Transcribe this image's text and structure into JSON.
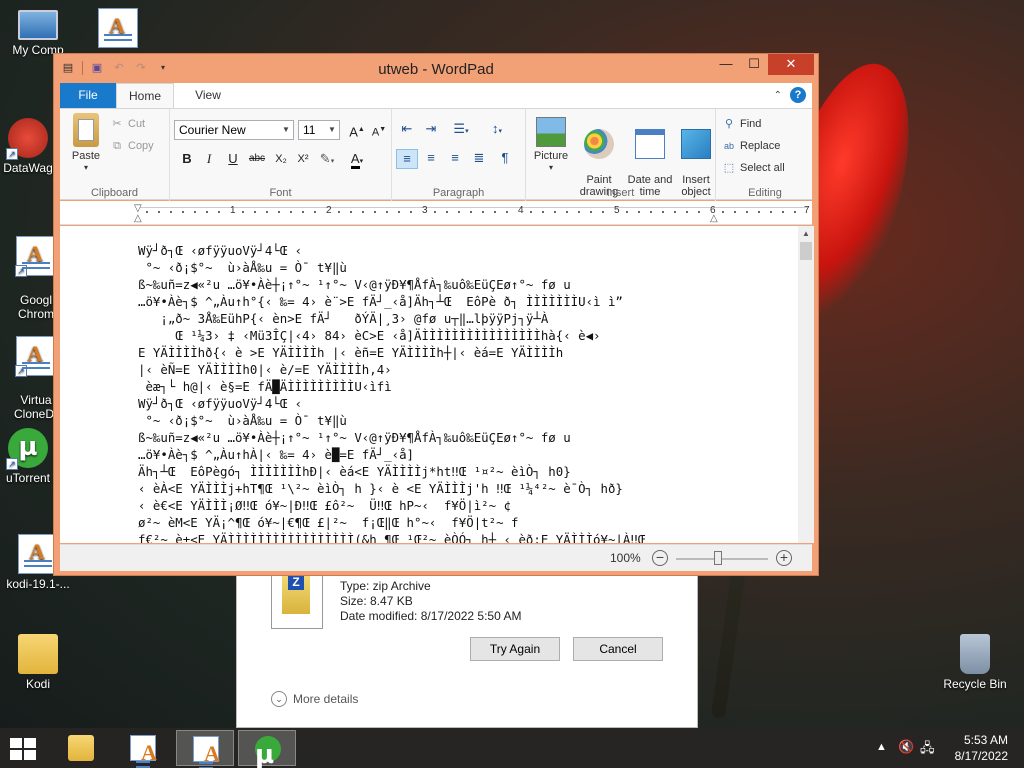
{
  "desktop": {
    "icons": [
      {
        "label": "My Comp",
        "icon": "computer-icon"
      },
      {
        "label": "",
        "icon": "wordpad-doc-icon"
      },
      {
        "label": "DataWag",
        "icon": "datawag-icon"
      },
      {
        "label": "Googl\nChrom",
        "icon": "wordpad-doc-icon"
      },
      {
        "label": "Virtua\nCloneDr",
        "icon": "wordpad-doc-icon"
      },
      {
        "label": "uTorrent",
        "icon": "utorrent-icon"
      },
      {
        "label": "kodi-19.1-...",
        "icon": "wordpad-doc-icon"
      },
      {
        "label": "Kodi",
        "icon": "folder-icon"
      },
      {
        "label": "Recycle Bin",
        "icon": "recycle-bin-icon"
      }
    ]
  },
  "dialog": {
    "type": "Type: zip Archive",
    "size": "Size: 8.47 KB",
    "modified": "Date modified: 8/17/2022 5:50 AM",
    "try_again": "Try Again",
    "cancel": "Cancel",
    "more_details": "More details"
  },
  "window": {
    "title": "utweb - WordPad",
    "tabs": {
      "file": "File",
      "home": "Home",
      "view": "View"
    },
    "clipboard": {
      "paste": "Paste",
      "cut": "Cut",
      "copy": "Copy",
      "label": "Clipboard"
    },
    "font": {
      "family": "Courier New",
      "size": "11",
      "label": "Font"
    },
    "paragraph": {
      "label": "Paragraph"
    },
    "insert": {
      "picture": "Picture",
      "paint_drawing": "Paint\ndrawing",
      "date_time": "Date and\ntime",
      "insert_object": "Insert\nobject",
      "label": "Insert"
    },
    "editing": {
      "find": "Find",
      "replace": "Replace",
      "select_all": "Select all",
      "label": "Editing"
    },
    "ruler_numbers": [
      "1",
      "2",
      "3",
      "4",
      "5",
      "6",
      "7"
    ],
    "document_lines": [
      "Wÿ┘ð┐Œ ‹øfÿÿuoVÿ┘4└Œ ‹",
      " °~ ‹ð¡$°~  ù›àÅ‰u = Ò¯ t¥‖ù",
      "ß~‰uñ=z◀«²u …ö¥•Àè┼¡↑°~ ¹↑°~ V‹@↑ÿÐ¥¶ÅfÀ┐‰uô‰EüÇEø↑°~ fø u",
      "…ö¥•Àè┐$ ^„Àu↑h°{‹ ‰= 4› è¨>E fÄ┘_‹å]Äh┐┴Œ  EôPè ð┐ ÌÌÌÌÌÌÌU‹ì ì”",
      "   ¡„ð~ 3Å‰EühP{‹ èn>E fÄ┘   ðÝÄ|¸3› @fø u┬‖…lþÿÿPj┐ÿ┴À",
      "     Œ ¹¼3› ‡ ‹Mü3ÎÇ|‹4› 84› èC>E ‹å]ÄÌÌÌÌÌÌÌÌÌÌÌÌÌÌÌÌhà{‹ è◀›",
      "E YÄÌÌÌÌhð{‹ è >E YÄÌÌÌÌh |‹ èñ=E YÄÌÌÌÌh┼|‹ èá=E YÄÌÌÌÌh",
      "|‹ èÑ=E YÄÌÌÌÌh0|‹ è∕=E YÄÌÌÌÌh,4›",
      " èæ┐└ h@|‹ è§=E fÄ█ÄÌÌÌÌÌÌÌÌÌU‹ìfì",
      "Wÿ┘ð┐Œ ‹øfÿÿuoVÿ┘4└Œ ‹",
      " °~ ‹ð¡$°~  ù›àÅ‰u = Ò¯ t¥‖ù",
      "ß~‰uñ=z◀«²u …ö¥•Àè┼¡↑°~ ¹↑°~ V‹@↑ÿÐ¥¶ÅfÀ┐‰uô‰EüÇEø↑°~ fø u",
      "…ö¥•Àè┐$ ^„Àu↑hÀ|‹ ‰= 4› è█=E fÄ┘_‹å]",
      "Äh┐┴Œ  EôPègó┐ ÌÌÌÌÌÌÌhÐ|‹ èá<E YÄÌÌÌÌj*ht‼Œ ¹¤²~ èìÒ┐ h0}",
      "‹ èÀ<E YÄÌÌÌj+hT¶Œ ¹\\²~ èìÒ┐ h }‹ è <E YÄÌÌÌj'h ‼Œ ¹¼⁴²~ è¯Ò┐ hð}",
      "‹ è€<E YÄÌÌÌ¡Ø‼Œ ó¥~|Ð‼Œ £ô²~  Ü‼Œ hP~‹  f¥Ö|ì²~ ¢",
      "ø²~ èM<E YÄ¡^¶Œ ó¥~|€¶Œ £|²~  f¡Œ‖Œ h°~‹  f¥Ö|t²~ f",
      "f€²~ è±<E YÄÌÌÌÌÌÌÌÌÌÌÌÌÌÌÌÌÌ(&h ¶Œ ¹Œ²~ èÒÓ┐ h┼ ‹ èð:E YÄÌÌÌó¥~|À‼Œ"
    ],
    "zoom": "100%"
  },
  "taskbar": {
    "time": "5:53 AM",
    "date": "8/17/2022"
  }
}
